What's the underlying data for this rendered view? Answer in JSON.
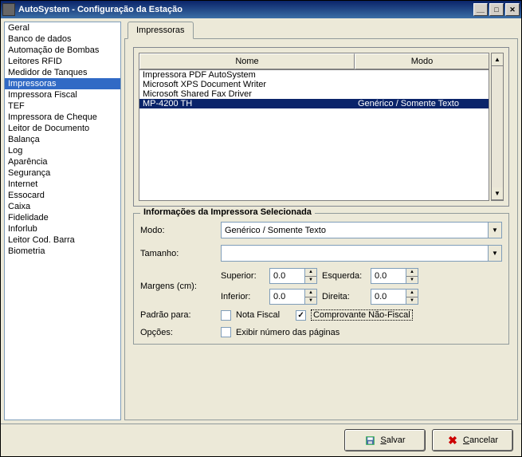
{
  "window": {
    "title": "AutoSystem - Configuração da Estação"
  },
  "sidebar": {
    "items": [
      {
        "label": "Geral"
      },
      {
        "label": "Banco de dados"
      },
      {
        "label": "Automação de Bombas"
      },
      {
        "label": "Leitores RFID"
      },
      {
        "label": "Medidor de Tanques"
      },
      {
        "label": "Impressoras",
        "selected": true
      },
      {
        "label": "Impressora Fiscal"
      },
      {
        "label": "TEF"
      },
      {
        "label": "Impressora de Cheque"
      },
      {
        "label": "Leitor de Documento"
      },
      {
        "label": "Balança"
      },
      {
        "label": "Log"
      },
      {
        "label": "Aparência"
      },
      {
        "label": "Segurança"
      },
      {
        "label": "Internet"
      },
      {
        "label": "Essocard"
      },
      {
        "label": "Caixa"
      },
      {
        "label": "Fidelidade"
      },
      {
        "label": "Inforlub"
      },
      {
        "label": "Leitor Cod. Barra"
      },
      {
        "label": "Biometria"
      }
    ]
  },
  "tabs": {
    "active": "Impressoras"
  },
  "table": {
    "headers": {
      "nome": "Nome",
      "modo": "Modo"
    },
    "rows": [
      {
        "nome": "Impressora PDF AutoSystem",
        "modo": ""
      },
      {
        "nome": "Microsoft XPS Document Writer",
        "modo": ""
      },
      {
        "nome": "Microsoft Shared Fax Driver",
        "modo": ""
      },
      {
        "nome": "MP-4200 TH",
        "modo": "Genérico / Somente Texto",
        "selected": true
      }
    ]
  },
  "details": {
    "title": "Informações da Impressora Selecionada",
    "modo_label": "Modo:",
    "modo_value": "Genérico / Somente Texto",
    "tamanho_label": "Tamanho:",
    "tamanho_value": "",
    "margens_label": "Margens (cm):",
    "superior_label": "Superior:",
    "superior_value": "0.0",
    "inferior_label": "Inferior:",
    "inferior_value": "0.0",
    "esquerda_label": "Esquerda:",
    "esquerda_value": "0.0",
    "direita_label": "Direita:",
    "direita_value": "0.0",
    "padrao_label": "Padrão para:",
    "nota_fiscal_label": "Nota Fiscal",
    "nota_fiscal_checked": false,
    "comprovante_label": "Comprovante Não-Fiscal",
    "comprovante_checked": true,
    "opcoes_label": "Opções:",
    "exibir_label": "Exibir número das páginas",
    "exibir_checked": false
  },
  "footer": {
    "save_label": "Salvar",
    "cancel_label": "Cancelar"
  }
}
